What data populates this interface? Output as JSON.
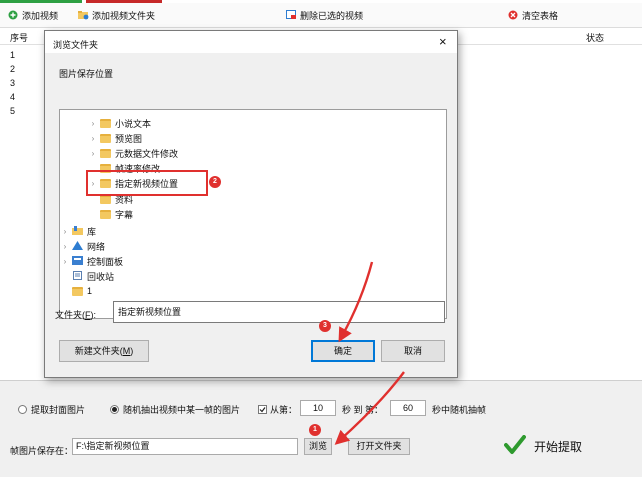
{
  "toolbar": {
    "add_video": "添加视频",
    "add_video_folder": "添加视频文件夹",
    "delete_selected": "删除已选的视频",
    "clear_table": "清空表格"
  },
  "table": {
    "col_seq": "序号",
    "col_status": "状态",
    "rows": [
      "1",
      "2",
      "3",
      "4",
      "5"
    ]
  },
  "dialog": {
    "title": "浏览文件夹",
    "close": "×",
    "description": "图片保存位置",
    "tree": [
      {
        "label": "小说文本",
        "icon": "folder-icon"
      },
      {
        "label": "预览图",
        "icon": "folder-icon"
      },
      {
        "label": "元数据文件修改",
        "icon": "folder-icon"
      },
      {
        "label": "帧速率修改",
        "icon": "folder-icon"
      },
      {
        "label": "指定新视频位置",
        "icon": "folder-icon"
      },
      {
        "label": "资料",
        "icon": "folder-icon"
      },
      {
        "label": "字幕",
        "icon": "folder-icon"
      },
      {
        "label": "库",
        "icon": "library-icon"
      },
      {
        "label": "网络",
        "icon": "network-icon"
      },
      {
        "label": "控制面板",
        "icon": "control-panel-icon"
      },
      {
        "label": "回收站",
        "icon": "recycle-bin-icon"
      },
      {
        "label": "1",
        "icon": "folder-icon"
      }
    ],
    "folder_label": "文件夹(",
    "folder_label_key": "F",
    "folder_label_end": "):",
    "folder_value": "指定新视频位置",
    "new_folder_btn": "新建文件夹(",
    "new_folder_key": "M",
    "new_folder_end": ")",
    "ok_btn": "确定",
    "cancel_btn": "取消"
  },
  "options": {
    "radio_cover": "提取封面图片",
    "radio_random": "随机抽出视频中某一帧的图片",
    "check_from": "从第：",
    "from_value": "10",
    "sec_to": "秒 到 第：",
    "to_value": "60",
    "sec_random": "秒中随机抽帧"
  },
  "save": {
    "label": "帧图片保存在：",
    "path": "F:\\指定新视频位置",
    "browse_btn": "浏览",
    "open_folder_btn": "打开文件夹",
    "start_btn": "开始提取"
  },
  "badges": [
    "1",
    "2",
    "3"
  ],
  "colors": {
    "accent_red": "#e0302e",
    "start_green": "#2e9a2e"
  }
}
